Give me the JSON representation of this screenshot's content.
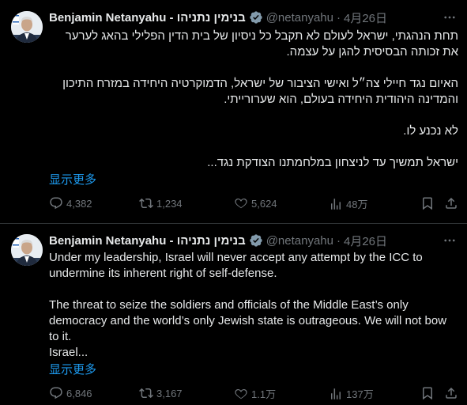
{
  "tweets": [
    {
      "author": {
        "name": "Benjamin Netanyahu - בנימין נתניהו",
        "handle": "@netanyahu",
        "separator": "·",
        "date": "4月26日"
      },
      "paragraphs": [
        "תחת הנהגתי, ישראל לעולם לא תקבל כל ניסיון של בית הדין הפלילי בהאג לערער את זכותה הבסיסית להגן על עצמה.",
        "האיום נגד חיילי צה״ל ואישי הציבור של ישראל, הדמוקרטיה היחידה במזרח התיכון והמדינה היהודית היחידה בעולם, הוא שערורייתי.",
        "לא נכנע לו.",
        "ישראל תמשיך עד לניצחון במלחמתנו הצודקת נגד..."
      ],
      "show_more": "显示更多",
      "stats": {
        "replies": "4,382",
        "retweets": "1,234",
        "likes": "5,624",
        "views": "48万"
      }
    },
    {
      "author": {
        "name": "Benjamin Netanyahu - בנימין נתניהו",
        "handle": "@netanyahu",
        "separator": "·",
        "date": "4月26日"
      },
      "paragraphs": [
        "Under my leadership, Israel will never accept any attempt by the ICC to undermine its inherent right of self-defense.",
        "The threat to seize the soldiers and officials of the Middle East’s only democracy and the world’s only Jewish state is outrageous. We will not bow to it.",
        "Israel..."
      ],
      "show_more": "显示更多",
      "stats": {
        "replies": "6,846",
        "retweets": "3,167",
        "likes": "1.1万",
        "views": "137万"
      }
    }
  ],
  "icons": {
    "verified": "verified-badge-icon",
    "more": "more-options-icon",
    "reply": "reply-icon",
    "retweet": "retweet-icon",
    "like": "like-icon",
    "views": "views-icon",
    "bookmark": "bookmark-icon",
    "share": "share-icon"
  },
  "colors": {
    "background": "#000000",
    "text": "#e7e9ea",
    "muted": "#71767b",
    "link": "#1d9bf0",
    "verified": "#829aab",
    "divider": "#2f3336"
  }
}
